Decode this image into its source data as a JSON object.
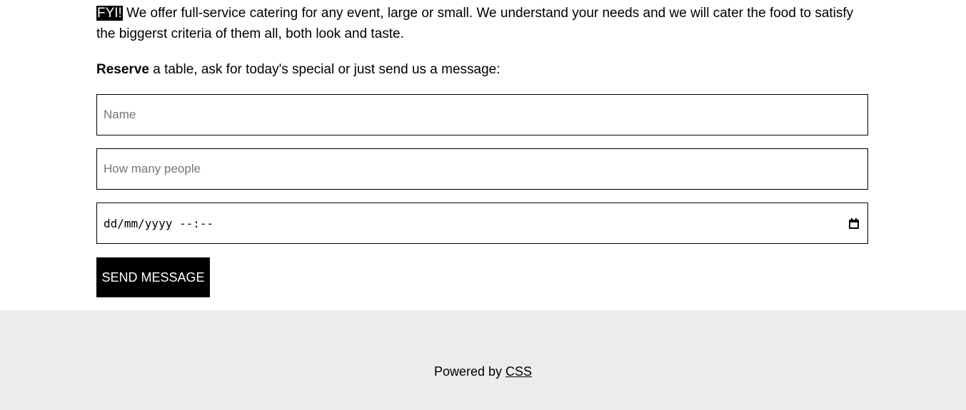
{
  "intro": {
    "badge": "FYI!",
    "text": " We offer full-service catering for any event, large or small. We understand your needs and we will cater the food to satisfy the biggerst criteria of them all, both look and taste."
  },
  "reserve": {
    "bold": "Reserve",
    "text": " a table, ask for today's special or just send us a message:"
  },
  "form": {
    "name_placeholder": "Name",
    "people_placeholder": "How many people",
    "datetime_placeholder": "dd/mm/yyyy --:--",
    "calendar_icon": "calendar-icon",
    "submit_label": "SEND MESSAGE"
  },
  "footer": {
    "prefix": "Powered by ",
    "link_label": "CSS"
  },
  "colors": {
    "button_bg": "#000000",
    "footer_bg": "#ececec"
  }
}
